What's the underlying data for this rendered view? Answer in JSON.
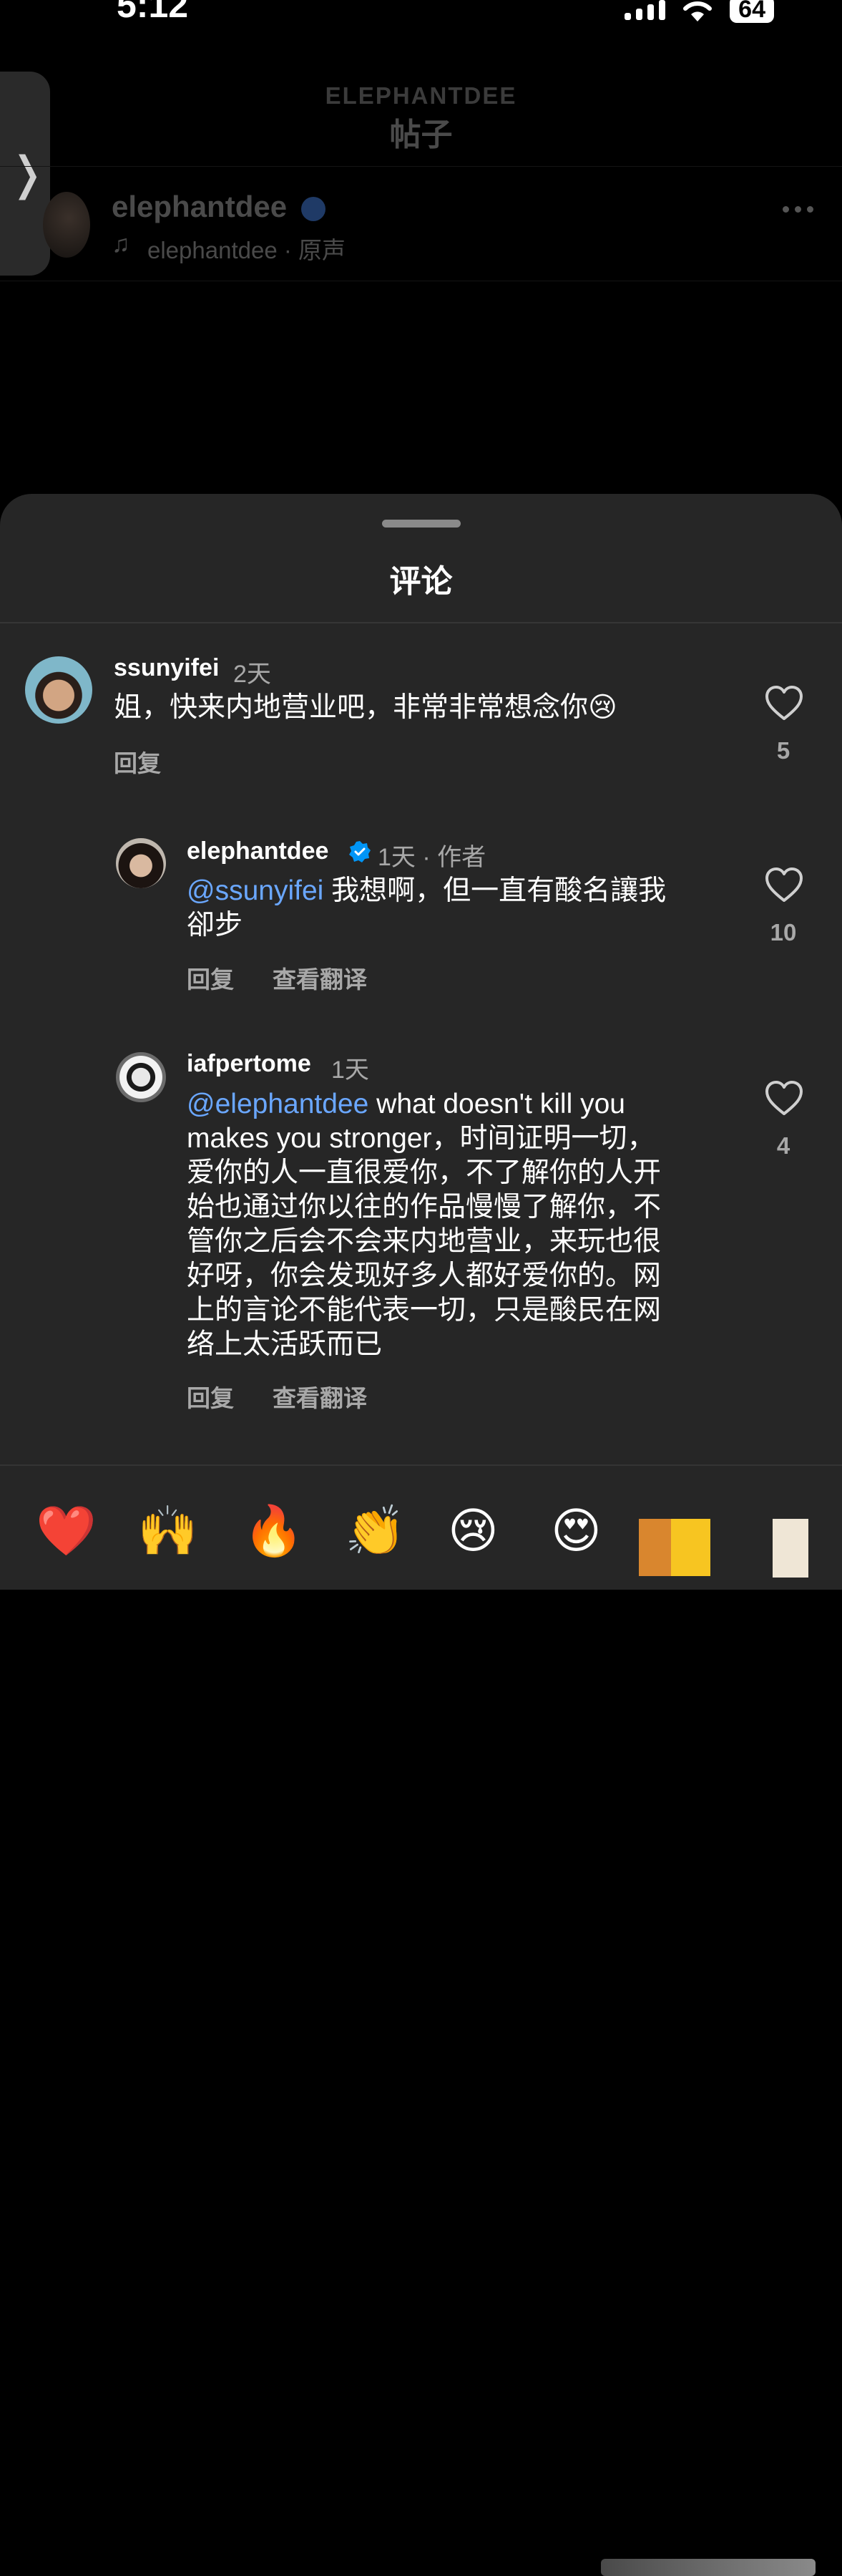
{
  "status_bar": {
    "time": "5:12",
    "battery": "64"
  },
  "post": {
    "eyebrow": "ELEPHANTDEE",
    "title": "帖子",
    "author": "elephantdee",
    "audio": "elephantdee · 原声"
  },
  "comments_sheet": {
    "title": "评论",
    "comments": [
      {
        "username": "ssunyifei",
        "meta": "2天",
        "text": "姐，快来内地营业吧，非常非常想念你😢",
        "reply_label": "回复",
        "likes": "5"
      },
      {
        "username": "elephantdee",
        "meta": "1天 · 作者",
        "mention": "@ssunyifei",
        "text_line1": "我想啊，但一直有酸名讓我",
        "text_line2": "卻步",
        "reply_label": "回复",
        "translate_label": "查看翻译",
        "likes": "10"
      },
      {
        "username": "iafpertome",
        "meta": "1天",
        "mention": "@elephantdee",
        "text_line1": "what doesn't kill you",
        "text_line2": "makes you stronger，时间证明一切，",
        "text_line3": "爱你的人一直很爱你，不了解你的人开",
        "text_line4": "始也通过你以往的作品慢慢了解你，不",
        "text_line5": "管你之后会不会来内地营业，来玩也很",
        "text_line6": "好呀，你会发现好多人都好爱你的。网",
        "text_line7": "上的言论不能代表一切，只是酸民在网",
        "text_line8": "络上太活跃而已",
        "reply_label": "回复",
        "translate_label": "查看翻译",
        "likes": "4"
      }
    ]
  },
  "emoji_bar": [
    "❤️",
    "🙌",
    "🔥",
    "👏",
    "😢",
    "😍"
  ],
  "colors": {
    "accent": "#0095f6",
    "mention": "#6aa7ff",
    "sheet_bg": "#262626",
    "heart": "#ff2a3a"
  }
}
